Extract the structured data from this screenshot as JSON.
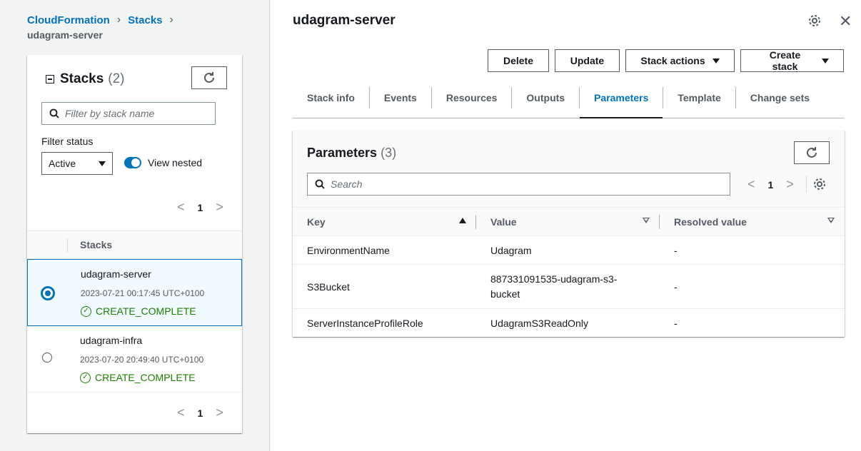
{
  "breadcrumb": {
    "items": [
      "CloudFormation",
      "Stacks"
    ],
    "current": "udagram-server"
  },
  "stacks_panel": {
    "title": "Stacks",
    "count": "(2)",
    "filter_placeholder": "Filter by stack name",
    "filter_status_label": "Filter status",
    "filter_status_value": "Active",
    "view_nested_label": "View nested",
    "page": "1",
    "column_header": "Stacks",
    "rows": [
      {
        "name": "udagram-server",
        "date": "2023-07-21 00:17:45 UTC+0100",
        "status": "CREATE_COMPLETE",
        "selected": true
      },
      {
        "name": "udagram-infra",
        "date": "2023-07-20 20:49:40 UTC+0100",
        "status": "CREATE_COMPLETE",
        "selected": false
      }
    ]
  },
  "detail": {
    "title": "udagram-server",
    "buttons": {
      "delete": "Delete",
      "update": "Update",
      "stack_actions": "Stack actions",
      "create_stack": "Create stack"
    },
    "tabs": [
      "Stack info",
      "Events",
      "Resources",
      "Outputs",
      "Parameters",
      "Template",
      "Change sets"
    ],
    "active_tab": "Parameters"
  },
  "parameters": {
    "title": "Parameters",
    "count": "(3)",
    "search_placeholder": "Search",
    "page": "1",
    "columns": [
      "Key",
      "Value",
      "Resolved value"
    ],
    "rows": [
      {
        "key": "EnvironmentName",
        "value": "Udagram",
        "resolved": "-"
      },
      {
        "key": "S3Bucket",
        "value": "887331091535-udagram-s3-bucket",
        "resolved": "-"
      },
      {
        "key": "ServerInstanceProfileRole",
        "value": "UdagramS3ReadOnly",
        "resolved": "-"
      }
    ]
  },
  "colors": {
    "link": "#0073bb",
    "success": "#1d8102",
    "text": "#16191f"
  }
}
